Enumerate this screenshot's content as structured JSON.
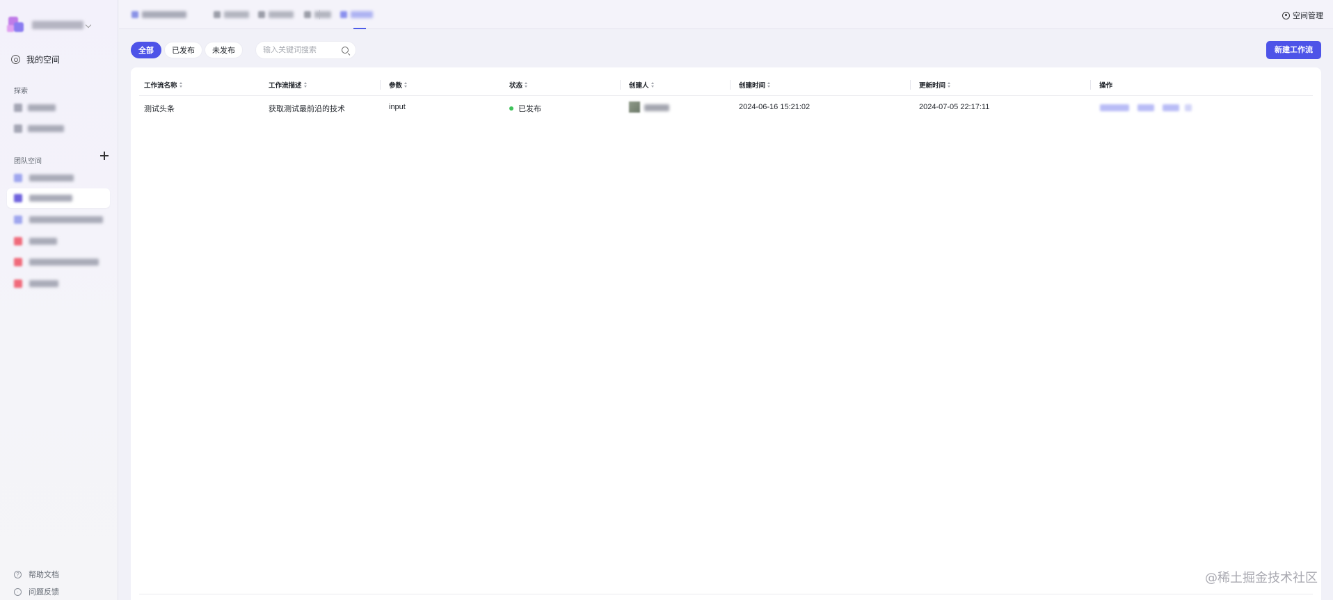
{
  "sidebar": {
    "my_space_label": "我的空间",
    "explore_label": "探索",
    "team_space_label": "团队空间",
    "help_docs_label": "帮助文档",
    "feedback_label": "问题反馈",
    "explore_items_count_hint": 2
  },
  "topnav": {
    "space_manage_label": "空间管理"
  },
  "filters": {
    "all_label": "全部",
    "published_label": "已发布",
    "unpublished_label": "未发布",
    "search_placeholder": "输入关键词搜索",
    "active": "全部"
  },
  "toolbar": {
    "new_workflow_label": "新建工作流"
  },
  "table": {
    "columns": [
      "工作流名称",
      "工作流描述",
      "参数",
      "状态",
      "创建人",
      "创建时间",
      "更新时间",
      "操作"
    ],
    "rows": [
      {
        "name": "测试头条",
        "description": "获取测试最前沿的技术",
        "params": "input",
        "status": "已发布",
        "created_at": "2024-06-16 15:21:02",
        "updated_at": "2024-07-05 22:17:11"
      }
    ]
  },
  "watermark": "@稀土掘金技术社区",
  "colors": {
    "accent": "#4d53e8",
    "status_published": "#3ec25a"
  }
}
